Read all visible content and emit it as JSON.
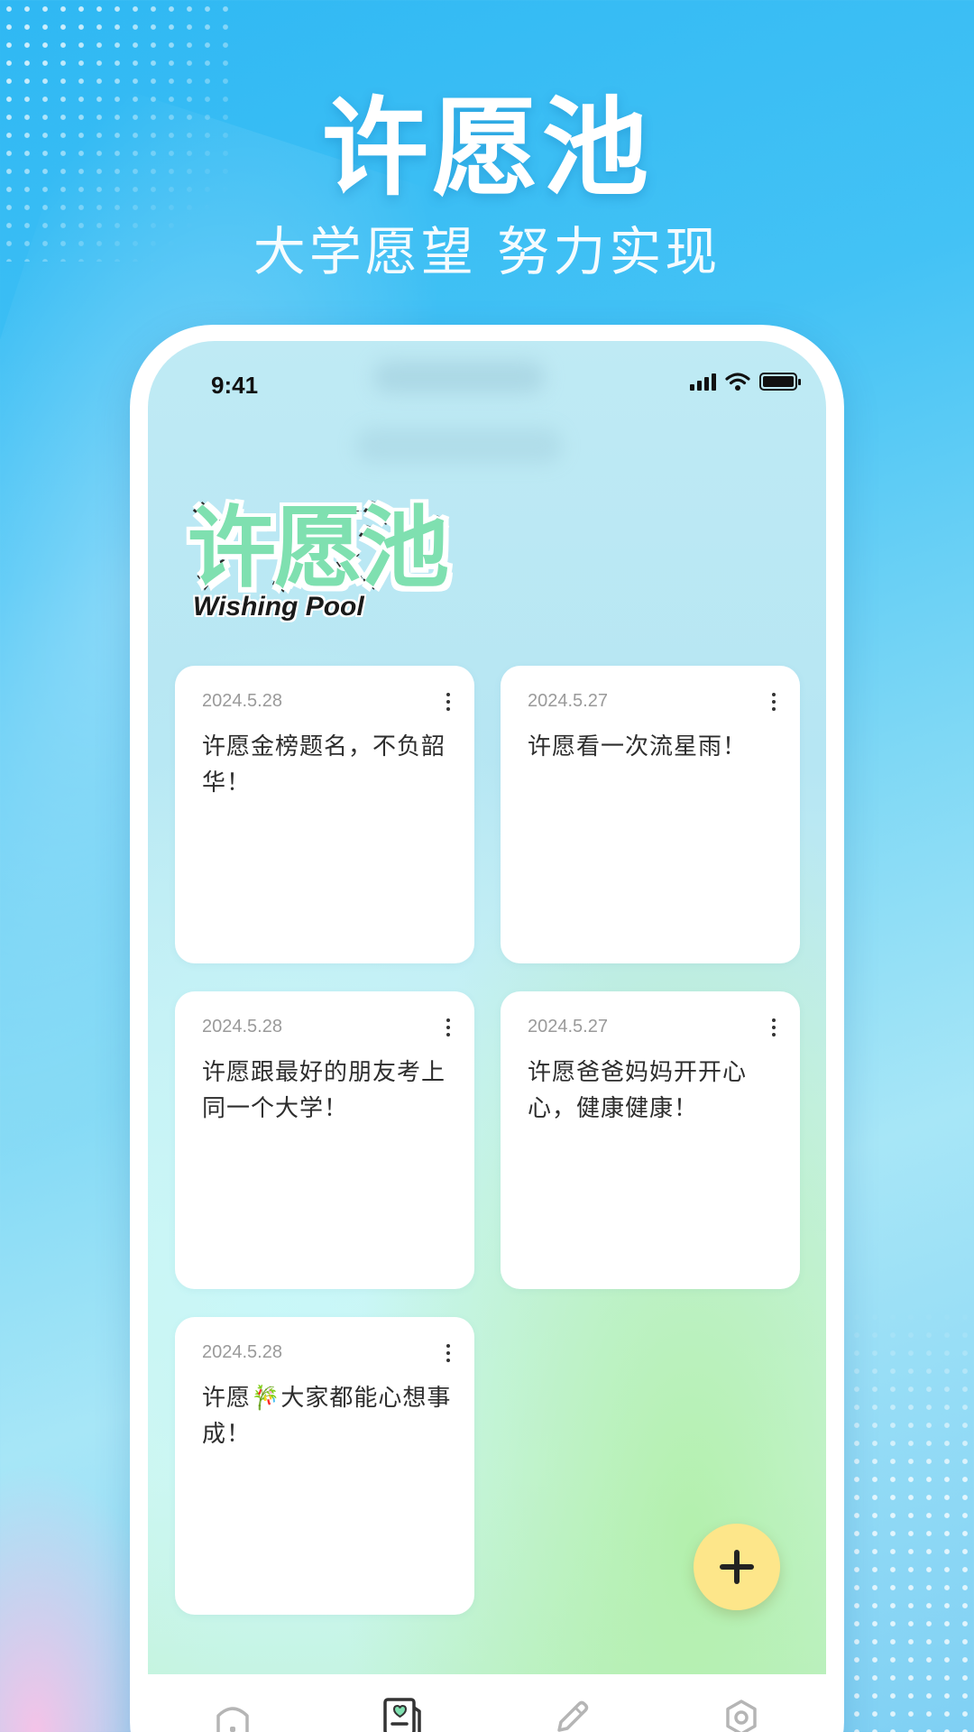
{
  "banner": {
    "title": "许愿池",
    "subtitle": "大学愿望  努力实现"
  },
  "status_bar": {
    "time": "9:41"
  },
  "app": {
    "title": "许愿池",
    "subtitle": "Wishing Pool"
  },
  "wishes": [
    {
      "date": "2024.5.28",
      "text": "许愿金榜题名，不负韶华！"
    },
    {
      "date": "2024.5.27",
      "text": "许愿看一次流星雨！"
    },
    {
      "date": "2024.5.28",
      "text": "许愿跟最好的朋友考上同一个大学！"
    },
    {
      "date": "2024.5.27",
      "text": "许愿爸爸妈妈开开心心，健康健康！"
    },
    {
      "date": "2024.5.28",
      "text": "许愿🎋大家都能心想事成！"
    }
  ],
  "tab_bar": {
    "items": [
      {
        "icon": "home-icon"
      },
      {
        "icon": "wish-book-icon",
        "active": true
      },
      {
        "icon": "pencil-icon"
      },
      {
        "icon": "settings-icon"
      }
    ]
  },
  "colors": {
    "accent": "#7fe0b0",
    "fab": "#fde68a",
    "tab_active": "#333333",
    "tab_inactive": "#b5b5b5"
  }
}
